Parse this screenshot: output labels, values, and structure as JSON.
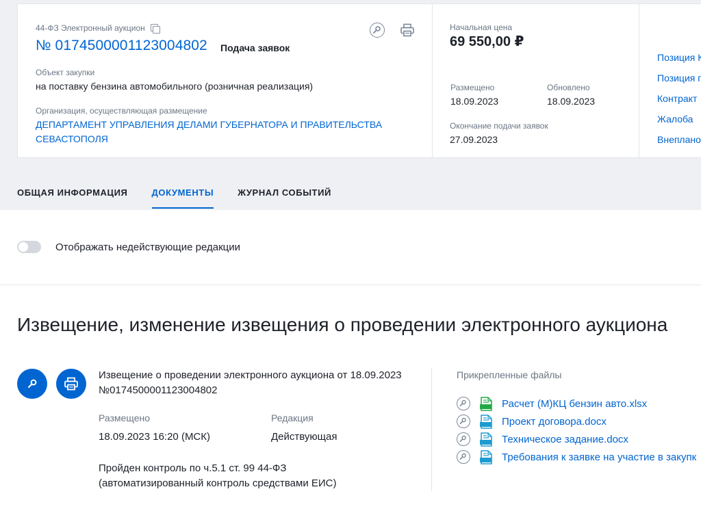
{
  "header": {
    "law_type": "44-ФЗ Электронный аукцион",
    "reg_number": "№ 0174500001123004802",
    "stage": "Подача заявок",
    "object_label": "Объект закупки",
    "object_value": "на поставку бензина автомобильного (розничная реализация)",
    "org_label": "Организация, осуществляющая размещение",
    "org_value": "ДЕПАРТАМЕНТ УПРАВЛЕНИЯ ДЕЛАМИ ГУБЕРНАТОРА И ПРАВИТЕЛЬСТВА СЕВАСТОПОЛЯ"
  },
  "price": {
    "label": "Начальная цена",
    "value": "69 550,00 ₽"
  },
  "dates": {
    "posted_label": "Размещено",
    "posted_value": "18.09.2023",
    "updated_label": "Обновлено",
    "updated_value": "18.09.2023",
    "deadline_label": "Окончание подачи заявок",
    "deadline_value": "27.09.2023"
  },
  "side_links": [
    "Позиция К",
    "Позиция п",
    "Контракт",
    "Жалоба",
    "Внеплано"
  ],
  "tabs": [
    {
      "label": "ОБЩАЯ ИНФОРМАЦИЯ",
      "active": false
    },
    {
      "label": "ДОКУМЕНТЫ",
      "active": true
    },
    {
      "label": "ЖУРНАЛ СОБЫТИЙ",
      "active": false
    }
  ],
  "toggle": {
    "label": "Отображать недействующие редакции",
    "on": false
  },
  "section": {
    "title": "Извещение, изменение извещения о проведении электронного аукциона"
  },
  "document": {
    "description_line1": "Извещение о проведении электронного аукциона от 18.09.2023",
    "description_line2": "№0174500001123004802",
    "posted_label": "Размещено",
    "posted_value": "18.09.2023 16:20 (МСК)",
    "edition_label": "Редакция",
    "edition_value": "Действующая",
    "control_line1": "Пройден контроль по ч.5.1 ст. 99 44-ФЗ",
    "control_line2": "(автоматизированный контроль средствами ЕИС)"
  },
  "files": {
    "title": "Прикрепленные файлы",
    "items": [
      {
        "name": "Расчет (М)КЦ бензин авто.xlsx",
        "type": "xlsx",
        "icon": "xlsx-file-icon",
        "color": "#22a845"
      },
      {
        "name": "Проект договора.docx",
        "type": "docx",
        "icon": "docx-file-icon",
        "color": "#1d9bd1"
      },
      {
        "name": "Техническое задание.docx",
        "type": "docx",
        "icon": "docx-file-icon",
        "color": "#1d9bd1"
      },
      {
        "name": "Требования к заявке на участие в закупк",
        "type": "docx",
        "icon": "docx-file-icon",
        "color": "#1d9bd1"
      }
    ]
  },
  "colors": {
    "accent": "#0065d1",
    "muted": "#6b7684",
    "background": "#eef0f3"
  }
}
